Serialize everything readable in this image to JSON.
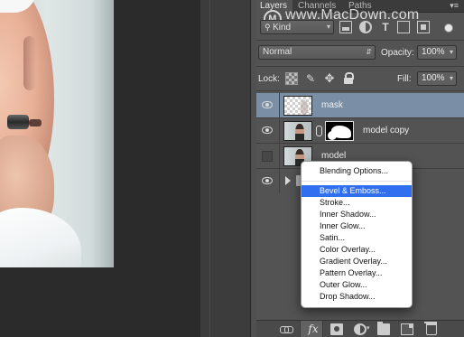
{
  "panel": {
    "tabs": [
      {
        "label": "Layers",
        "active": true
      },
      {
        "label": "Channels",
        "active": false
      },
      {
        "label": "Paths",
        "active": false
      }
    ],
    "menu_glyph": "▾≡"
  },
  "watermark": {
    "logo_glyph": "M",
    "text": "www.MacDown.com"
  },
  "filter": {
    "kind_label": "Kind",
    "type_glyph": "T"
  },
  "blend": {
    "mode": "Normal",
    "opacity_label": "Opacity:",
    "opacity_value": "100%"
  },
  "lock": {
    "label": "Lock:",
    "paint_glyph": "✎",
    "move_glyph": "✥",
    "fill_label": "Fill:",
    "fill_value": "100%"
  },
  "layers": [
    {
      "name": "mask",
      "visible": true,
      "selected": true
    },
    {
      "name": "model copy",
      "visible": true,
      "selected": false
    },
    {
      "name": "model",
      "visible": false,
      "selected": false
    },
    {
      "name": "",
      "visible": true,
      "selected": false,
      "group": true
    }
  ],
  "toolbar": {
    "fx_label": "fx",
    "caret": "▾"
  },
  "fx_menu": {
    "items": [
      "Blending Options...",
      "Bevel & Emboss...",
      "Stroke...",
      "Inner Shadow...",
      "Inner Glow...",
      "Satin...",
      "Color Overlay...",
      "Gradient Overlay...",
      "Pattern Overlay...",
      "Outer Glow...",
      "Drop Shadow..."
    ],
    "highlighted": "Bevel & Emboss..."
  },
  "colors": {
    "selected_row": "#7a8fa6",
    "menu_highlight": "#2f6ff0",
    "panel_bg": "#535353"
  }
}
